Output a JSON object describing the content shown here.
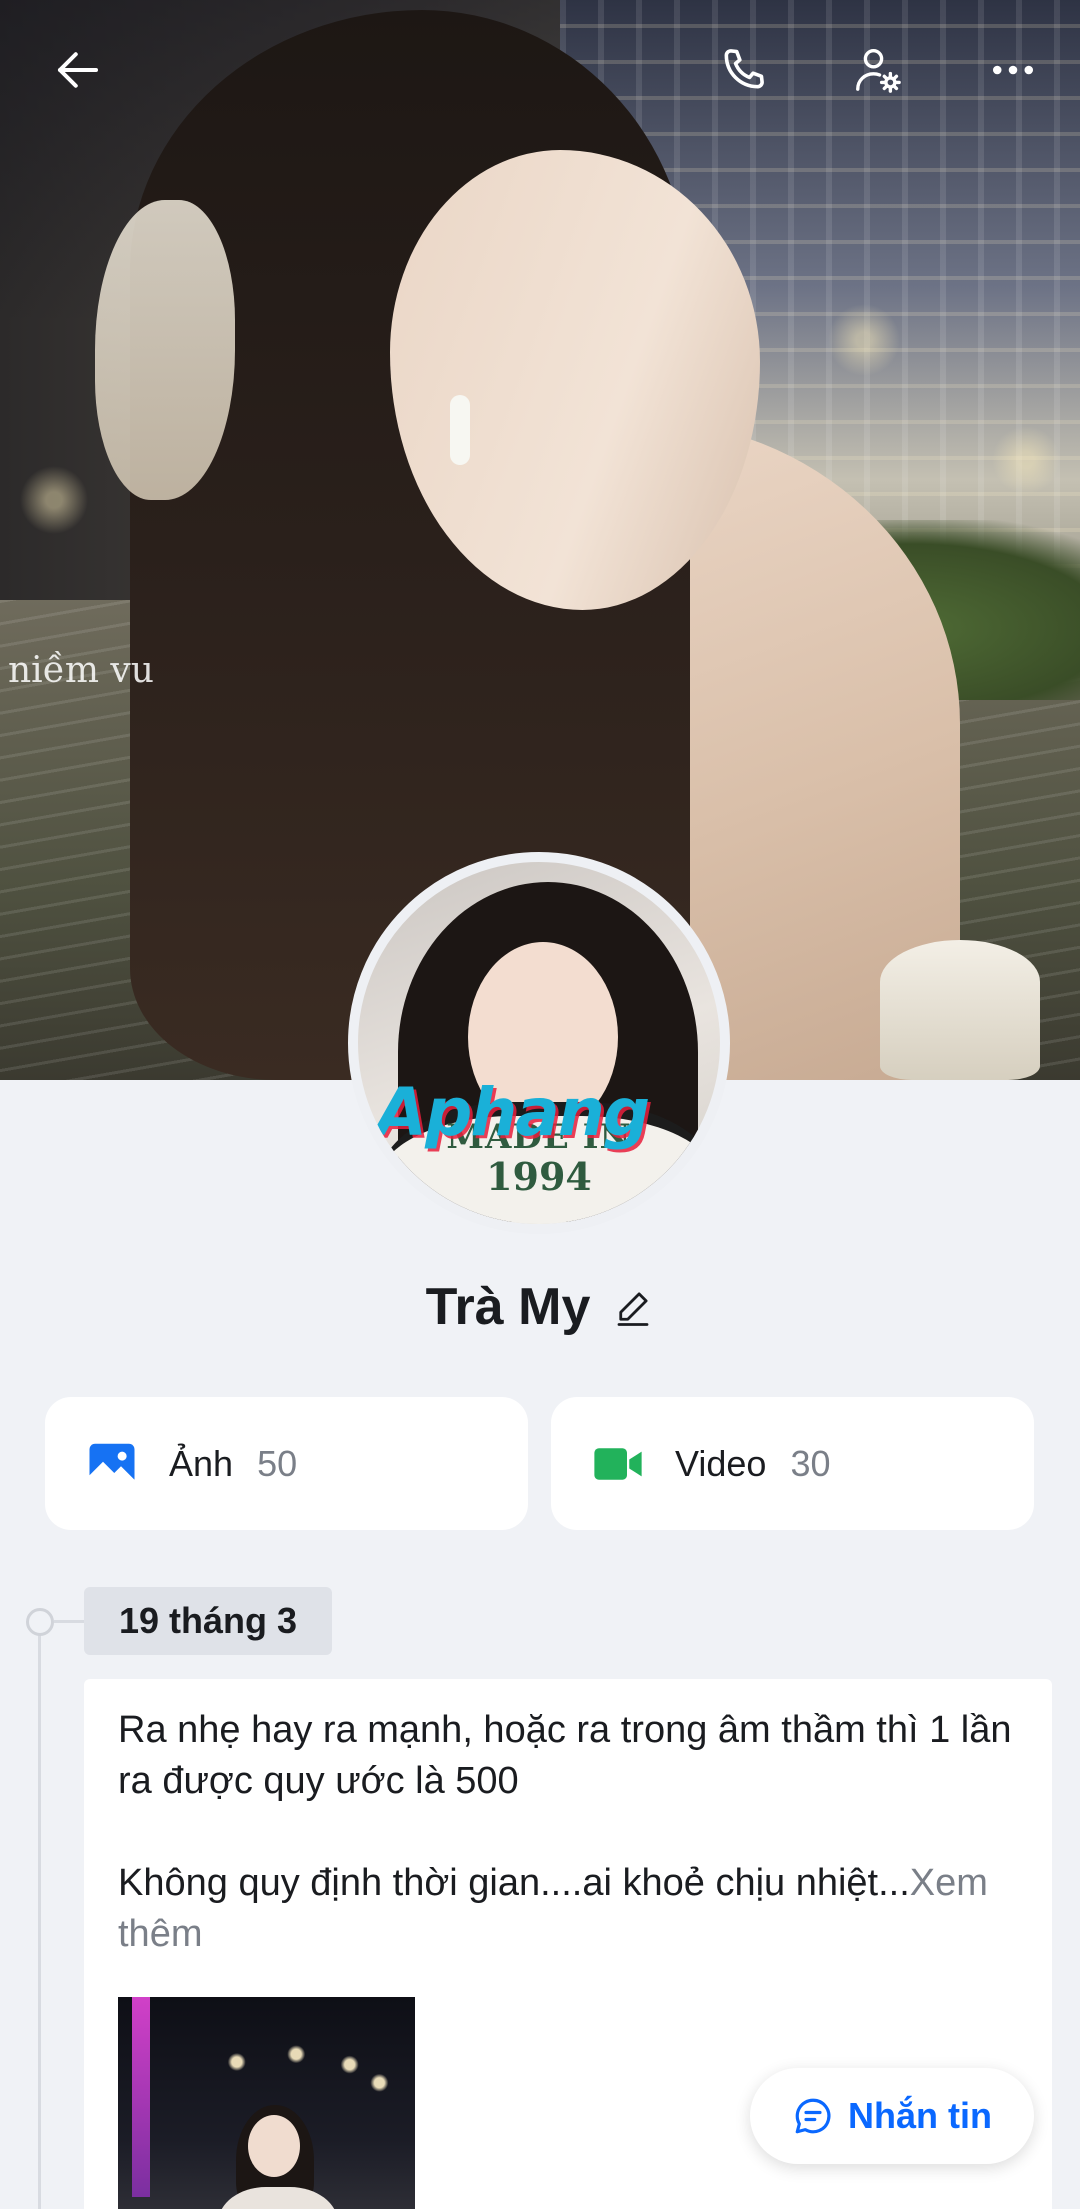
{
  "cover": {
    "overlay_text": "niềm vu"
  },
  "topbar": {
    "back_icon": "arrow-left-icon",
    "call_icon": "phone-icon",
    "settings_icon": "user-settings-icon",
    "more_icon": "more-horizontal-icon"
  },
  "profile": {
    "name": "Trà My",
    "avatar_text": {
      "watermark": "Aphang",
      "shirt_line1": "MADE IN",
      "shirt_line2": "1994"
    }
  },
  "media": {
    "photos": {
      "label": "Ảnh",
      "count": "50",
      "icon": "image-icon",
      "color": "#1672f3"
    },
    "videos": {
      "label": "Video",
      "count": "30",
      "icon": "video-camera-icon",
      "color": "#22b25b"
    }
  },
  "timeline": {
    "date": "19 tháng 3",
    "post": {
      "paragraph1": "Ra nhẹ hay ra mạnh, hoặc ra trong âm thầm thì 1 lần ra được quy ước là 500",
      "paragraph2": "Không quy định thời gian....ai khoẻ chịu nhiệt...",
      "see_more": "Xem thêm"
    }
  },
  "message_button": {
    "label": "Nhắn tin",
    "icon": "chat-bubble-icon",
    "color": "#0a68ff"
  }
}
